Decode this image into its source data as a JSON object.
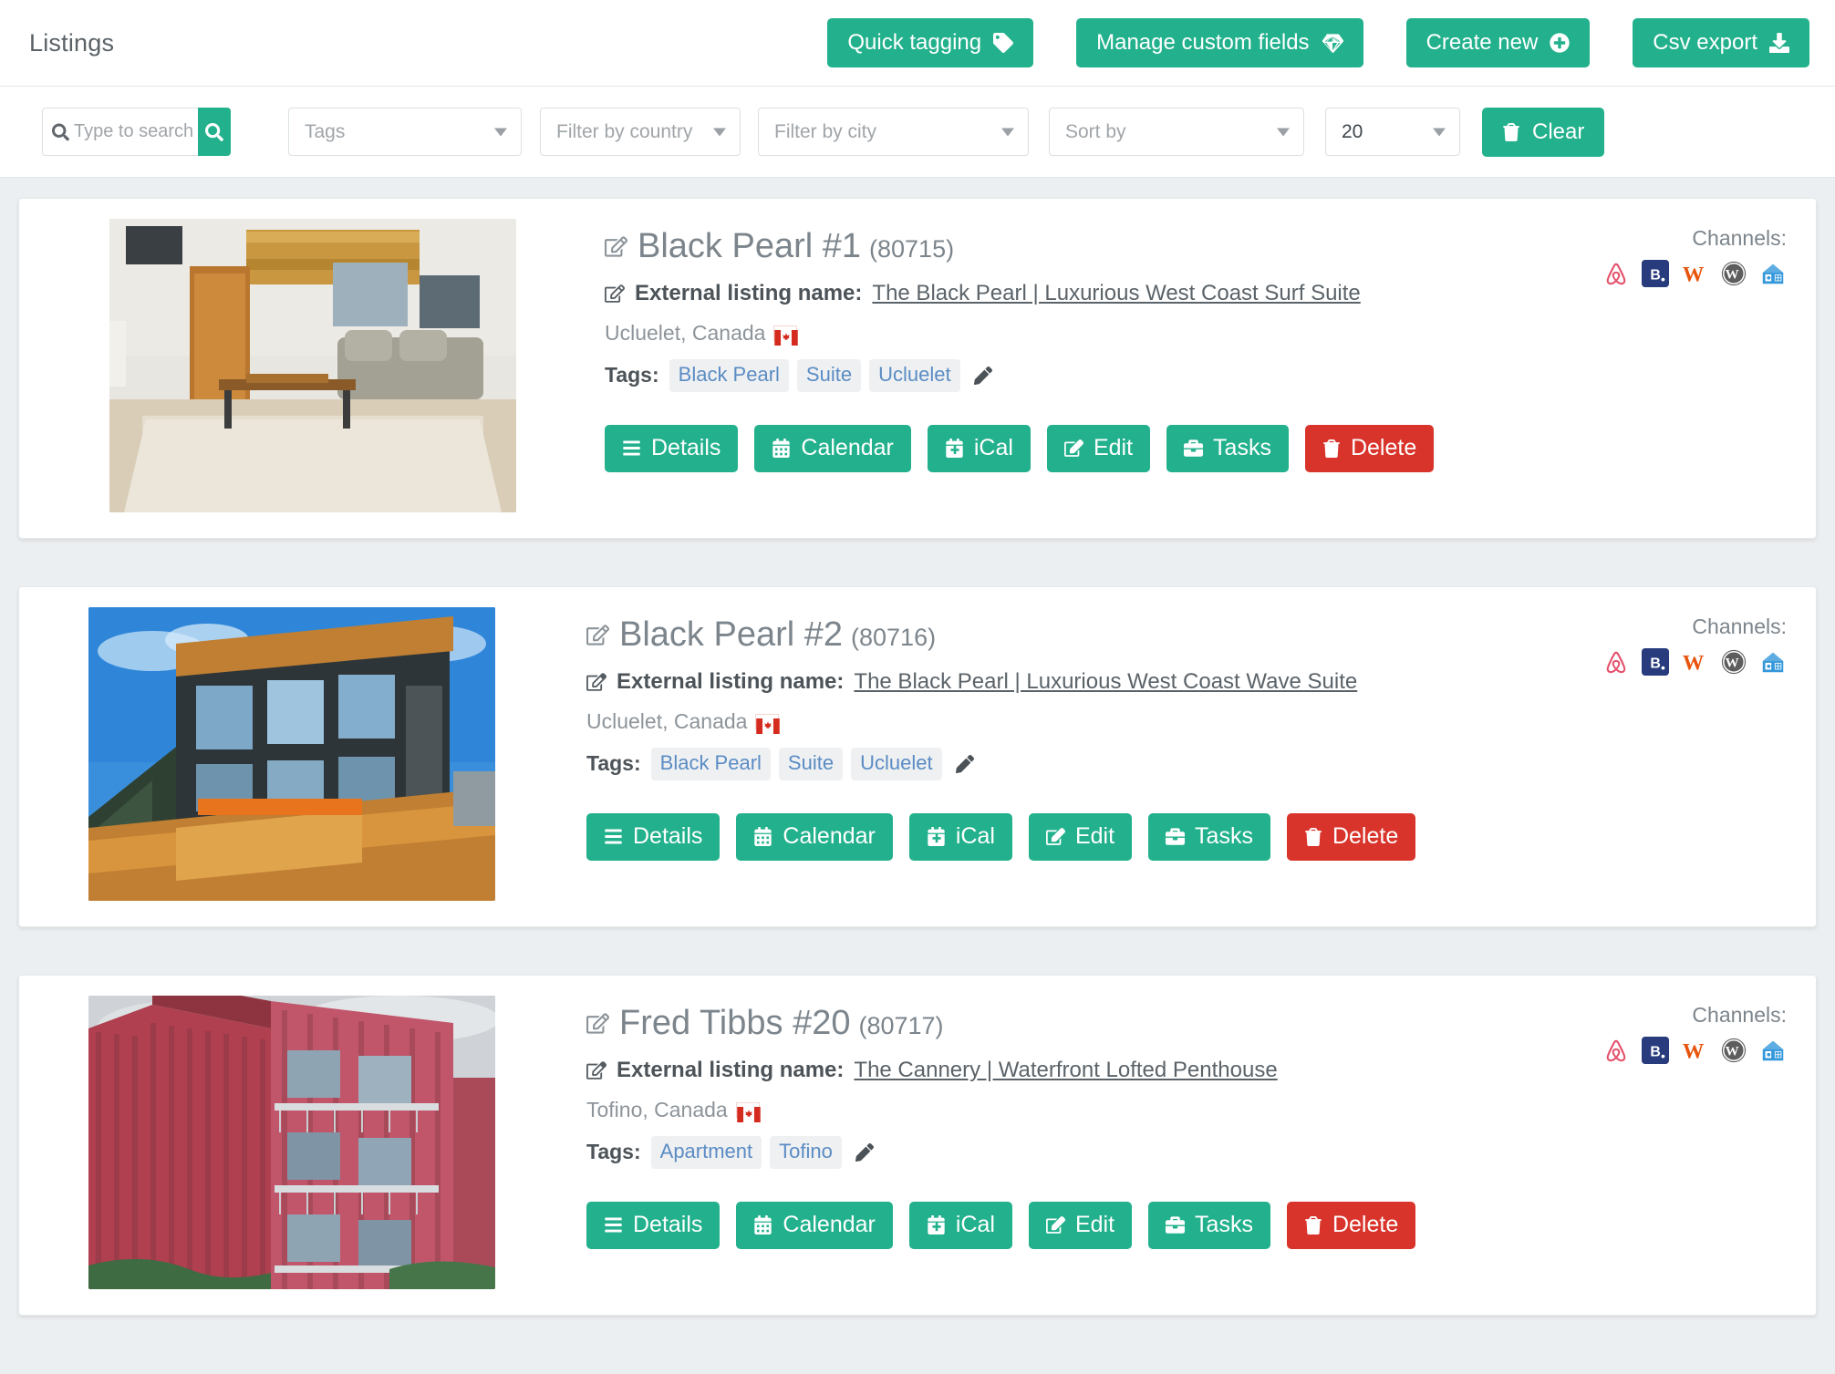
{
  "header": {
    "title": "Listings",
    "buttons": [
      {
        "label": "Quick tagging",
        "icon": "tag-icon"
      },
      {
        "label": "Manage custom fields",
        "icon": "gem-icon"
      },
      {
        "label": "Create new",
        "icon": "plus-circle-icon"
      },
      {
        "label": "Csv export",
        "icon": "download-icon"
      }
    ]
  },
  "filters": {
    "search": {
      "placeholder": "Type to search l",
      "value": "",
      "icon": "search-icon"
    },
    "tags": {
      "label": "Tags"
    },
    "country": {
      "label": "Filter by country"
    },
    "city": {
      "label": "Filter by city"
    },
    "sort": {
      "label": "Sort by"
    },
    "per_page": {
      "label": "20"
    },
    "clear": {
      "label": "Clear",
      "icon": "trash-icon"
    }
  },
  "labels": {
    "external_listing_name": "External listing name:",
    "tags": "Tags:",
    "channels": "Channels:"
  },
  "actions": {
    "details": "Details",
    "calendar": "Calendar",
    "ical": "iCal",
    "edit": "Edit",
    "tasks": "Tasks",
    "delete": "Delete"
  },
  "colors": {
    "primary": "#22b18c",
    "danger": "#d9342b",
    "tag_text": "#5b8cc4",
    "page_bg": "#eceff1"
  },
  "listings": [
    {
      "name": "Black Pearl #1",
      "id": "(80715)",
      "external_name": "The Black Pearl | Luxurious West Coast Surf Suite",
      "location": "Ucluelet, Canada",
      "flag": "canada-flag",
      "tags": [
        "Black Pearl",
        "Suite",
        "Ucluelet"
      ],
      "thumb": "interior-living-room",
      "channels": [
        "airbnb-icon",
        "booking-icon",
        "w-icon",
        "wordpress-icon",
        "house-icon"
      ]
    },
    {
      "name": "Black Pearl #2",
      "id": "(80716)",
      "external_name": "The Black Pearl | Luxurious West Coast Wave Suite",
      "location": "Ucluelet, Canada",
      "flag": "canada-flag",
      "tags": [
        "Black Pearl",
        "Suite",
        "Ucluelet"
      ],
      "thumb": "modern-dark-house",
      "channels": [
        "airbnb-icon",
        "booking-icon",
        "w-icon",
        "wordpress-icon",
        "house-icon"
      ]
    },
    {
      "name": "Fred Tibbs #20",
      "id": "(80717)",
      "external_name": "The Cannery | Waterfront Lofted Penthouse",
      "location": "Tofino, Canada",
      "flag": "canada-flag",
      "tags": [
        "Apartment",
        "Tofino"
      ],
      "thumb": "red-apartment-building",
      "channels": [
        "airbnb-icon",
        "booking-icon",
        "w-icon",
        "wordpress-icon",
        "house-icon"
      ]
    }
  ]
}
